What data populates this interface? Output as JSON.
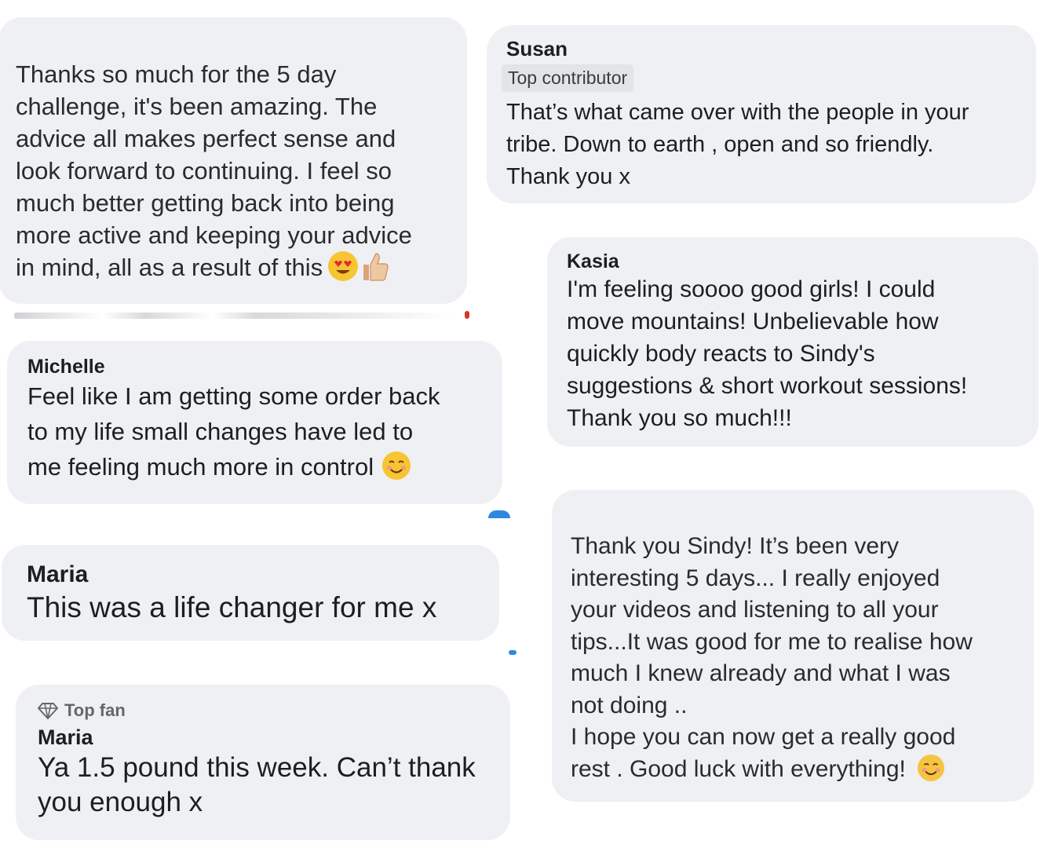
{
  "comments": {
    "c1": {
      "text": "Thanks so much for the 5 day\nchallenge, it's been amazing. The\nadvice all makes perfect sense and\nlook forward to continuing. I feel so\nmuch better getting back into being\nmore active and keeping your advice\nin mind, all as a result of this",
      "emojis": [
        "heart-eyes-face-icon",
        "thumbs-up-icon"
      ]
    },
    "c2": {
      "author": "Susan",
      "badge": "Top contributor",
      "text": "That’s what came over with the people in your\ntribe. Down to earth , open and so friendly.\nThank you x"
    },
    "c3": {
      "author": "Kasia",
      "text": "I'm feeling soooo good girls! I could\nmove mountains! Unbelievable how\nquickly body reacts to Sindy's\nsuggestions & short workout sessions!\nThank you so much!!!"
    },
    "c4": {
      "author": "Michelle",
      "text": "Feel like I am getting some order back\nto my life small changes have led to\nme feeling much more in control",
      "emoji": "smiling-face-icon"
    },
    "c5": {
      "text": "Thank you Sindy! It’s been very\ninteresting 5 days... I really enjoyed\nyour videos and listening to all your\ntips...It was good for me to realise how\nmuch I knew already and what I was\nnot doing ..\nI hope you can now get a really good\nrest . Good luck with everything!",
      "emoji": "smiling-face-icon"
    },
    "c6": {
      "author": "Maria",
      "text": "This was a life changer for me x"
    },
    "c7": {
      "badge": "Top fan",
      "badge_icon": "diamond-icon",
      "author": "Maria",
      "text": "Ya 1.5 pound this week. Can’t thank\nyou enough x"
    }
  },
  "colors": {
    "bubble": "#eff0f3",
    "text": "#1c1e21",
    "badge_bg": "#e2e4e8",
    "emoji_yellow": "#f7c531",
    "heart_red": "#e5243b"
  }
}
